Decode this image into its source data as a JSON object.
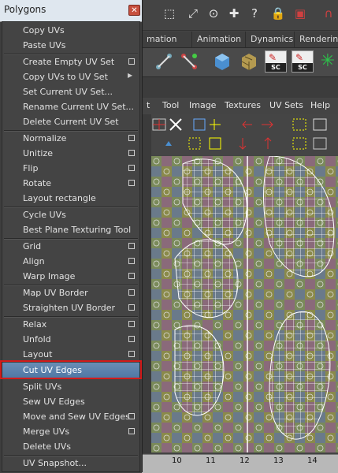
{
  "panel": {
    "title": "Polygons",
    "close_glyph": "✕"
  },
  "menu_items": [
    {
      "label": "Copy UVs",
      "option": false
    },
    {
      "label": "Paste UVs",
      "option": false
    },
    {
      "label": "Create Empty UV Set",
      "option": true
    },
    {
      "label": "Copy UVs to UV Set",
      "submenu": true
    },
    {
      "label": "Set Current UV Set...",
      "option": false
    },
    {
      "label": "Rename Current UV Set...",
      "option": false
    },
    {
      "label": "Delete Current UV Set",
      "option": false
    },
    {
      "label": "Normalize",
      "option": true
    },
    {
      "label": "Unitize",
      "option": true
    },
    {
      "label": "Flip",
      "option": true
    },
    {
      "label": "Rotate",
      "option": true
    },
    {
      "label": "Layout rectangle",
      "option": false
    },
    {
      "label": "Cycle UVs",
      "option": false
    },
    {
      "label": "Best Plane Texturing Tool",
      "option": false
    },
    {
      "label": "Grid",
      "option": true
    },
    {
      "label": "Align",
      "option": true
    },
    {
      "label": "Warp Image",
      "option": true
    },
    {
      "label": "Map UV Border",
      "option": true
    },
    {
      "label": "Straighten UV Border",
      "option": true
    },
    {
      "label": "Relax",
      "option": true
    },
    {
      "label": "Unfold",
      "option": true
    },
    {
      "label": "Layout",
      "option": true
    },
    {
      "label": "Cut UV Edges",
      "option": false,
      "selected": true
    },
    {
      "label": "Split UVs",
      "option": false
    },
    {
      "label": "Sew UV Edges",
      "option": false
    },
    {
      "label": "Move and Sew UV Edges",
      "option": true
    },
    {
      "label": "Merge UVs",
      "option": true
    },
    {
      "label": "Delete UVs",
      "option": false
    },
    {
      "label": "UV Snapshot...",
      "option": false
    }
  ],
  "shelf_tabs": [
    "mation",
    "Animation",
    "Dynamics",
    "Rendering"
  ],
  "shelf_icon_labels": [
    "SC",
    "SC"
  ],
  "editor_menu": [
    "t",
    "Tool",
    "Image",
    "Textures",
    "UV Sets",
    "Help"
  ],
  "ruler_ticks": [
    "10",
    "11",
    "12",
    "13",
    "14"
  ],
  "colors": {
    "highlight_border": "#d21b1b",
    "selected_item": "#5b82ad"
  }
}
